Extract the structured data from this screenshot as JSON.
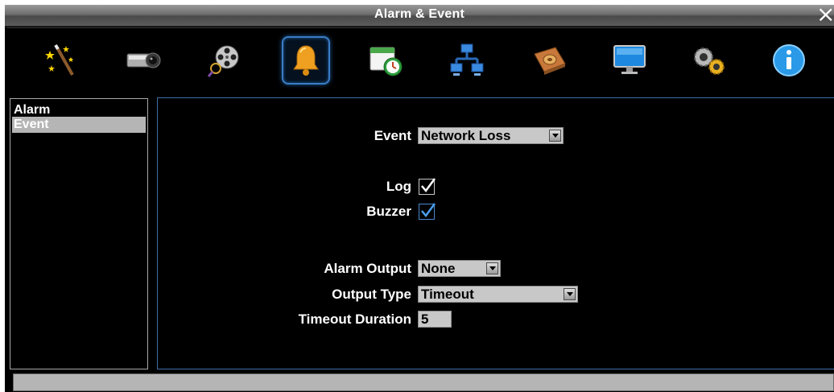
{
  "window": {
    "title": "Alarm & Event",
    "close_icon": "×"
  },
  "toolbar": {
    "items": [
      {
        "icon": "wizard-wand-icon",
        "active": false
      },
      {
        "icon": "camera-icon",
        "active": false
      },
      {
        "icon": "film-reel-icon",
        "active": false
      },
      {
        "icon": "bell-icon",
        "active": true
      },
      {
        "icon": "schedule-clock-icon",
        "active": false
      },
      {
        "icon": "network-icon",
        "active": false
      },
      {
        "icon": "storage-disk-icon",
        "active": false
      },
      {
        "icon": "monitor-icon",
        "active": false
      },
      {
        "icon": "gears-icon",
        "active": false
      },
      {
        "icon": "info-icon",
        "active": false
      }
    ]
  },
  "sidebar": {
    "items": [
      {
        "label": "Alarm",
        "selected": false
      },
      {
        "label": "Event",
        "selected": true
      }
    ]
  },
  "form": {
    "event_label": "Event",
    "event_value": "Network Loss",
    "log_label": "Log",
    "log_checked": true,
    "buzzer_label": "Buzzer",
    "buzzer_checked": true,
    "alarm_output_label": "Alarm Output",
    "alarm_output_value": "None",
    "output_type_label": "Output Type",
    "output_type_value": "Timeout",
    "timeout_duration_label": "Timeout Duration",
    "timeout_duration_value": "5"
  },
  "colors": {
    "active_border": "#3a7cc4",
    "panel_border": "#3e6fa8",
    "selected_bg": "#b5b5b5",
    "field_bg": "#c8c8c8"
  }
}
